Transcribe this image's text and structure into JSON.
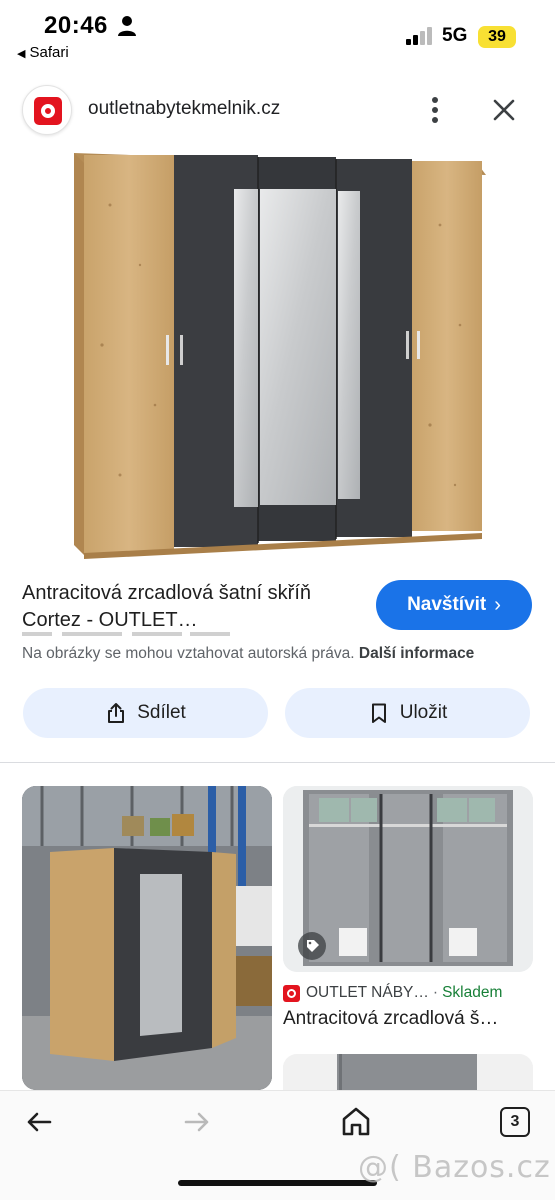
{
  "status_bar": {
    "time": "20:46",
    "back_app": "Safari",
    "network": "5G",
    "battery": "39"
  },
  "header": {
    "domain": "outletnabytekmelnik.cz",
    "favicon_icon": "outlet-logo-icon",
    "menu_icon": "more-vertical-icon",
    "close_icon": "close-icon"
  },
  "result": {
    "title": "Antracitová zrcadlová šatní skříň Cortez - OUTLET…",
    "visit_label": "Navštívit",
    "copyright_text": "Na obrázky se mohou vztahovat autorská práva.",
    "more_info_label": "Další informace",
    "share_label": "Sdílet",
    "save_label": "Uložit"
  },
  "related": {
    "source_name": "OUTLET NÁBY…",
    "stock_status": "Skladem",
    "item_title": "Antracitová zrcadlová š…"
  },
  "bottom_nav": {
    "tabs_count": "3"
  },
  "watermark": "@( Bazos.cz",
  "colors": {
    "accent": "#1a73e8",
    "action_button_bg": "#e8f0fe",
    "brand_red": "#e3141f",
    "stock_green": "#188038",
    "battery_yellow": "#f8e033"
  }
}
